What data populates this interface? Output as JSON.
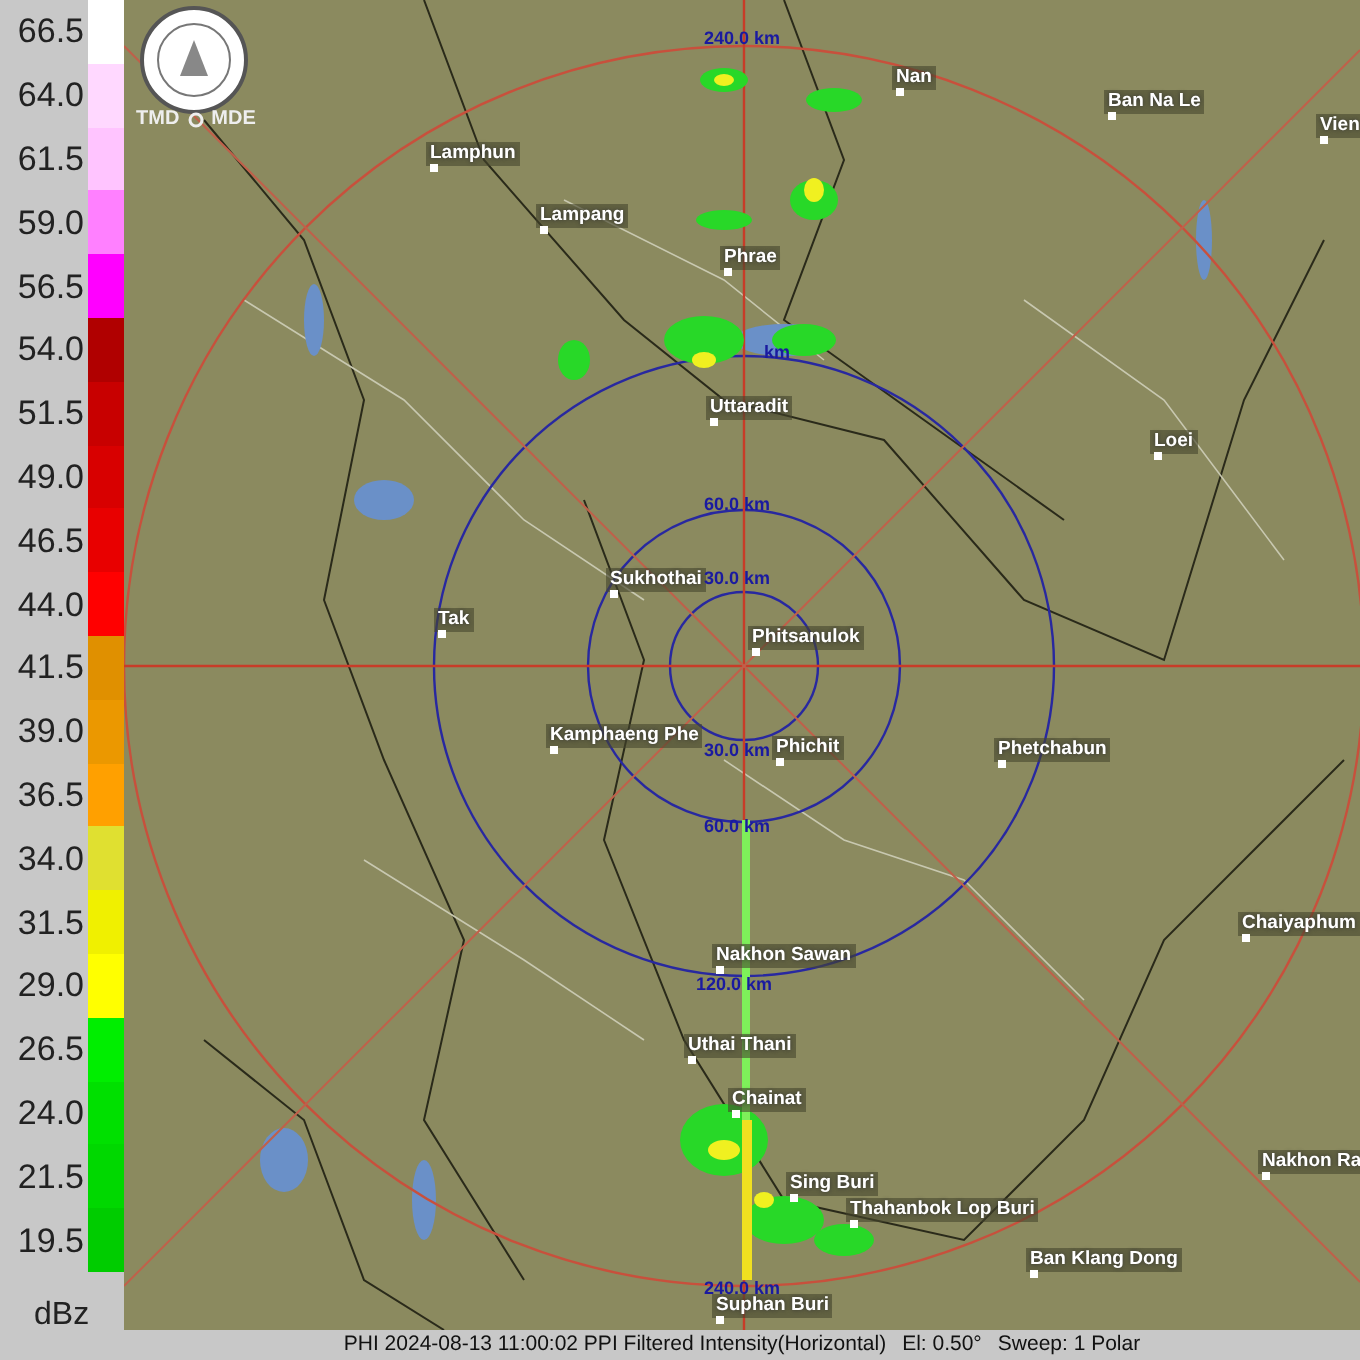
{
  "legend": {
    "unit": "dBz",
    "items": [
      {
        "label": "66.5",
        "color": "#ffffff"
      },
      {
        "label": "64.0",
        "color": "#ffd8ff"
      },
      {
        "label": "61.5",
        "color": "#ffc4ff"
      },
      {
        "label": "59.0",
        "color": "#ff80ff"
      },
      {
        "label": "56.5",
        "color": "#ff00ff"
      },
      {
        "label": "54.0",
        "color": "#b00000"
      },
      {
        "label": "51.5",
        "color": "#c80000"
      },
      {
        "label": "49.0",
        "color": "#d80000"
      },
      {
        "label": "46.5",
        "color": "#e80000"
      },
      {
        "label": "44.0",
        "color": "#ff0000"
      },
      {
        "label": "41.5",
        "color": "#e09000"
      },
      {
        "label": "39.0",
        "color": "#eb9800"
      },
      {
        "label": "36.5",
        "color": "#ffa000"
      },
      {
        "label": "34.0",
        "color": "#e0e030"
      },
      {
        "label": "31.5",
        "color": "#f0f000"
      },
      {
        "label": "29.0",
        "color": "#ffff00"
      },
      {
        "label": "26.5",
        "color": "#00ee00"
      },
      {
        "label": "24.0",
        "color": "#00e000"
      },
      {
        "label": "21.5",
        "color": "#00d800"
      },
      {
        "label": "19.5",
        "color": "#00cc00"
      }
    ]
  },
  "map": {
    "logo": {
      "left": "TMD",
      "right": "MDE"
    },
    "cities": [
      "Lamphun",
      "Lampang",
      "Nan",
      "Ban Na Le",
      "Vien",
      "Phrae",
      "Uttaradit",
      "Loei",
      "Sukhothai",
      "Tak",
      "Phitsanulok",
      "Kamphaeng Phe",
      "Phichit",
      "Phetchabun",
      "Chaiyaphum",
      "Nakhon Sawan",
      "Uthai Thani",
      "Chainat",
      "Sing Buri",
      "Thahanbok Lop Buri",
      "Nakhon Ra",
      "Ban Klang Dong",
      "Suphan Buri"
    ],
    "range_labels": [
      "240.0 km",
      "km",
      "60.0 km",
      "30.0 km",
      "30.0 km",
      "60.0 km",
      "120.0 km",
      "240.0 km"
    ]
  },
  "status_bar": [
    "PHI 2024-08-13 11:00:02 PPI Filtered Intensity(Horizontal)",
    "El: 0.50°",
    "Sweep: 1 Polar"
  ]
}
